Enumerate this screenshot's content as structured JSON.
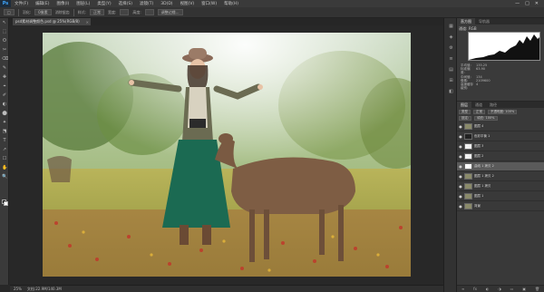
{
  "app": {
    "logo": "Ps"
  },
  "menu": [
    "文件(F)",
    "编辑(E)",
    "图像(I)",
    "图层(L)",
    "类型(Y)",
    "选择(S)",
    "滤镜(T)",
    "3D(D)",
    "视图(V)",
    "窗口(W)",
    "帮助(H)"
  ],
  "window_controls": [
    "—",
    "□",
    "✕"
  ],
  "options_bar": {
    "items": [
      "□",
      "羽化:",
      "0像素",
      "消除锯齿",
      "样式:",
      "正常",
      "宽度:",
      "高度:",
      "调整边缘..."
    ]
  },
  "document_tab": {
    "title": "psd素材调整颜色.psd @ 25%(RGB/8)",
    "close": "×"
  },
  "toolbar_icons": [
    "↖",
    "⬚",
    "ʘ",
    "✂",
    "⌫",
    "✎",
    "✚",
    "⌖",
    "✐",
    "◐",
    "⬤",
    "✦",
    "⬔",
    "T",
    "↗",
    "☐",
    "✋",
    "🔍"
  ],
  "status": {
    "zoom": "25%",
    "doc": "文档:22.9M/140.3M"
  },
  "icon_strip": [
    "▦",
    "◈",
    "⚙",
    "≡",
    "▤",
    "⊞",
    "◧"
  ],
  "histogram": {
    "tabs": [
      "直方图",
      "导航器"
    ],
    "channel": "通道:",
    "channel_value": "RGB",
    "stats": [
      [
        "平均值:",
        "135.25"
      ],
      [
        "标准偏差:",
        "63.90"
      ],
      [
        "中间值:",
        "134"
      ],
      [
        "像素:",
        "2109600"
      ],
      [
        "高速缓存级别:",
        "4"
      ]
    ]
  },
  "layers_panel": {
    "tabs": [
      "图层",
      "通道",
      "路径"
    ],
    "kind": "类型",
    "blend": "正常",
    "opacity": "不透明度: 100%",
    "fill": "填充: 100%",
    "lock": "锁定:",
    "layers": [
      {
        "name": "图层 4",
        "thumb": "photo"
      },
      {
        "name": "色彩平衡 1",
        "thumb": "adj"
      },
      {
        "name": "图层 3",
        "thumb": "white"
      },
      {
        "name": "图层 2",
        "thumb": "white"
      },
      {
        "name": "曲线 1 拷贝 2",
        "thumb": "mask"
      },
      {
        "name": "图层 1 拷贝 2",
        "thumb": "photo"
      },
      {
        "name": "图层 1 拷贝",
        "thumb": "photo"
      },
      {
        "name": "图层 1",
        "thumb": "photo"
      },
      {
        "name": "背景",
        "thumb": "photo"
      }
    ],
    "footer": [
      "∞",
      "fx",
      "◐",
      "◑",
      "▭",
      "▣",
      "🗑"
    ]
  }
}
